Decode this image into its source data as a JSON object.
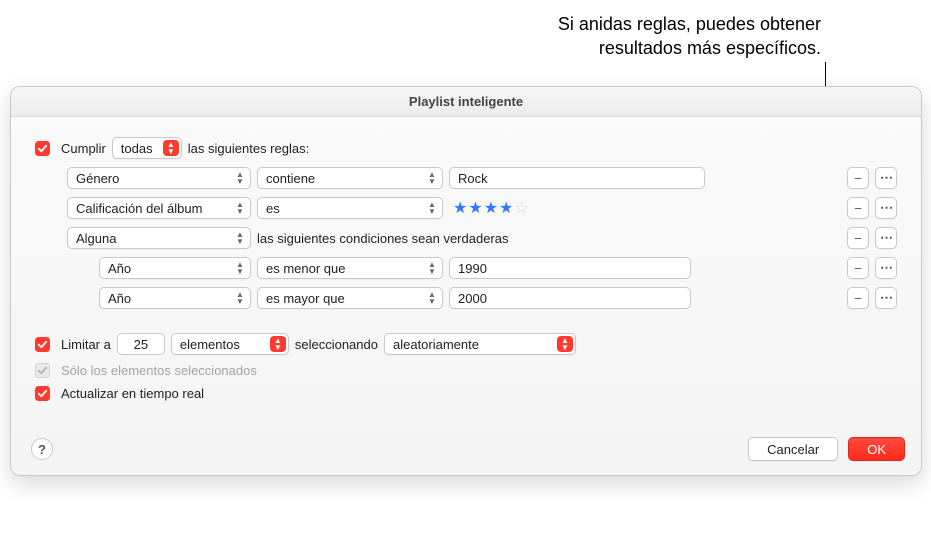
{
  "callout": {
    "line1": "Si anidas reglas, puedes obtener",
    "line2": "resultados más específicos."
  },
  "window": {
    "title": "Playlist inteligente"
  },
  "match": {
    "checked": true,
    "prefix": "Cumplir",
    "scope": "todas",
    "suffix": "las siguientes reglas:"
  },
  "rules": [
    {
      "field": "Género",
      "op": "contiene",
      "value": "Rock"
    },
    {
      "field": "Calificación del álbum",
      "op": "es",
      "stars_filled": 4,
      "stars_empty": 1
    }
  ],
  "nested": {
    "scope": "Alguna",
    "suffix": "las siguientes condiciones sean verdaderas",
    "rules": [
      {
        "field": "Año",
        "op": "es menor que",
        "value": "1990"
      },
      {
        "field": "Año",
        "op": "es mayor que",
        "value": "2000"
      }
    ]
  },
  "limit": {
    "checked": true,
    "prefix": "Limitar a",
    "count": "25",
    "unit": "elementos",
    "middle": "seleccionando",
    "method": "aleatoriamente"
  },
  "only_selected": {
    "checked": true,
    "disabled": true,
    "label": "Sólo los elementos seleccionados"
  },
  "live_update": {
    "checked": true,
    "label": "Actualizar en tiempo real"
  },
  "buttons": {
    "help": "?",
    "cancel": "Cancelar",
    "ok": "OK"
  }
}
